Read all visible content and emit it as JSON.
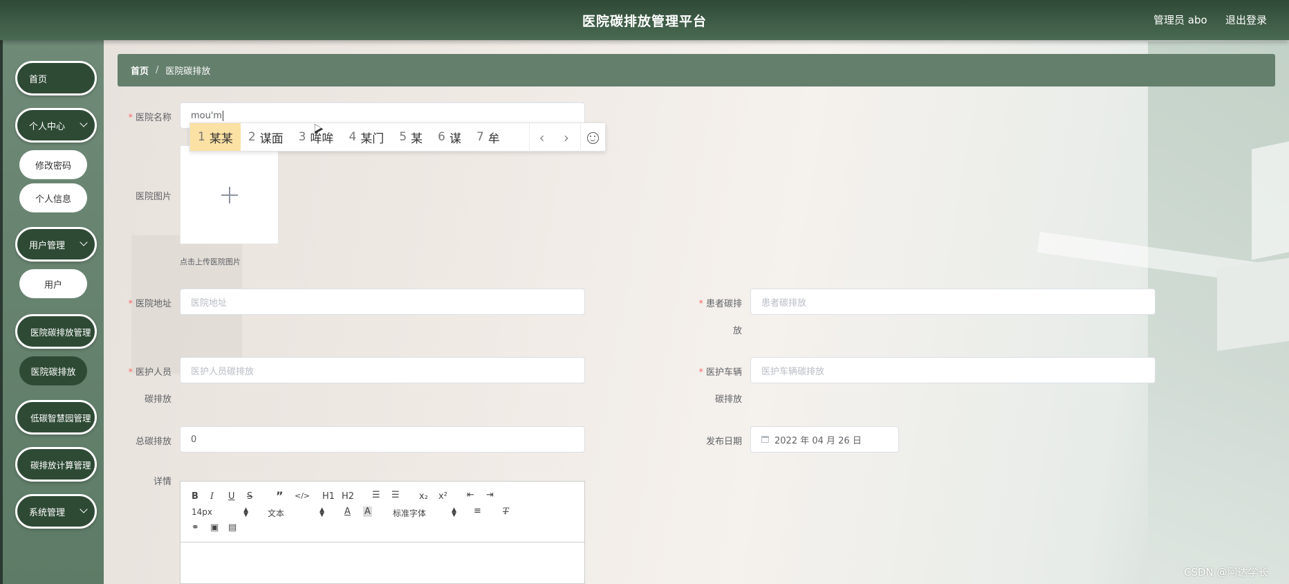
{
  "header": {
    "title": "医院碳排放管理平台",
    "user": "管理员 abo",
    "logout": "退出登录"
  },
  "sidebar": {
    "home": "首页",
    "personal_center": "个人中心",
    "change_password": "修改密码",
    "personal_info": "个人信息",
    "user_management": "用户管理",
    "user": "用户",
    "hospital_emission_management": "医院碳排放管理",
    "hospital_emission": "医院碳排放",
    "low_carbon_management": "低碳智慧园管理",
    "calculation_management": "碳排放计算管理",
    "system_management": "系统管理"
  },
  "breadcrumb": {
    "home": "首页",
    "separator": "/",
    "current": "医院碳排放"
  },
  "form": {
    "hospital_name_label": "医院名称",
    "hospital_name_value": "mou'm",
    "hospital_image_label": "医院图片",
    "upload_tip": "点击上传医院图片",
    "address_label": "医院地址",
    "address_placeholder": "医院地址",
    "patient_label_1": "患者碳排",
    "patient_label_2": "放",
    "patient_placeholder": "患者碳排放",
    "staff_label_1": "医护人员",
    "staff_label_2": "碳排放",
    "staff_placeholder": "医护人员碳排放",
    "vehicle_label_1": "医护车辆",
    "vehicle_label_2": "碳排放",
    "vehicle_placeholder": "医护车辆碳排放",
    "total_label": "总碳排放",
    "total_value": "0",
    "date_label": "发布日期",
    "date_value": "2022 年 04 月 26 日",
    "details_label": "详情",
    "required_mark": "*"
  },
  "ime": {
    "candidates": [
      {
        "num": "1",
        "text": "某某"
      },
      {
        "num": "2",
        "text": "谋面"
      },
      {
        "num": "3",
        "text": "哞哞"
      },
      {
        "num": "4",
        "text": "某门"
      },
      {
        "num": "5",
        "text": "某"
      },
      {
        "num": "6",
        "text": "谋"
      },
      {
        "num": "7",
        "text": "牟"
      }
    ],
    "prev": "‹",
    "next": "›",
    "emoji_icon": "smile-icon"
  },
  "editor": {
    "font_size": "14px",
    "block_format": "文本",
    "font_family": "标准字体",
    "h1": "H1",
    "h2": "H2",
    "sub": "x₂",
    "sup": "x²"
  },
  "watermark": "CSDN @阿达学长",
  "colors": {
    "header_dark": "#2f4a37",
    "sidebar": "#6f8a77",
    "breadcrumb": "#647f6c",
    "nav_pill": "#2e4a35",
    "required": "#f56c6c",
    "ime_selected": "#fbe1a3"
  }
}
